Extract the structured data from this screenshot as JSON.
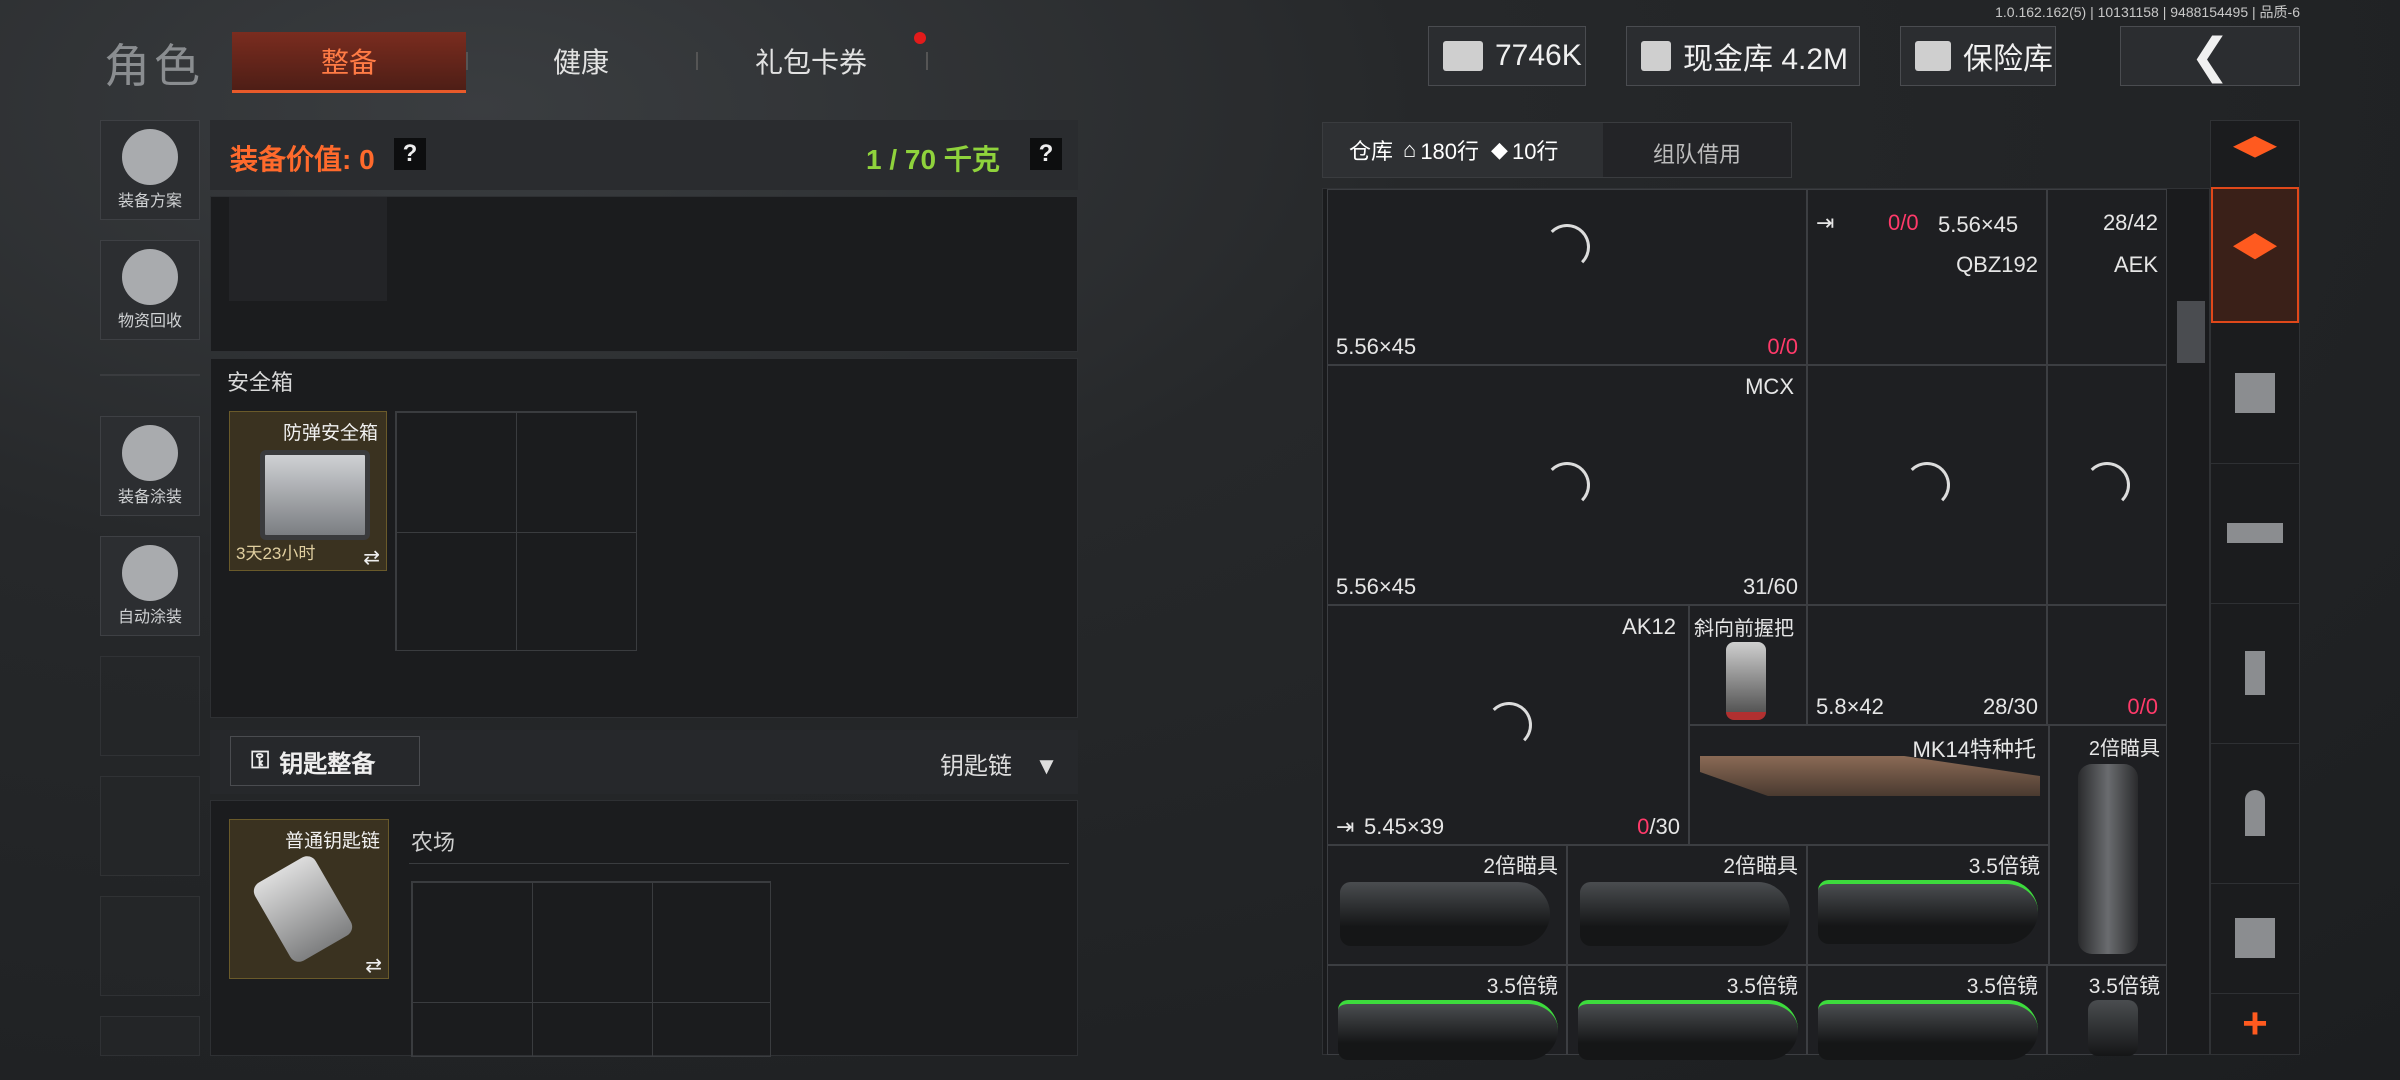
{
  "version": "1.0.162.162(5) | 10131158 | 9488154495 | 品质-6",
  "header": {
    "title": "角色",
    "tabs": [
      {
        "label": "整备",
        "active": true
      },
      {
        "label": "健康",
        "active": false
      },
      {
        "label": "礼包卡券",
        "active": false,
        "badge": true
      }
    ],
    "currency": "7746K",
    "cash_vault": "现金库 4.2M",
    "insurance": "保险库",
    "back_icon": "chevron-left-icon"
  },
  "left_menu": [
    {
      "label": "装备方案",
      "icon": "helmet-grid-icon"
    },
    {
      "label": "物资回收",
      "icon": "recycle-face-icon"
    },
    {
      "label": "装备涂装",
      "icon": "helmet-paint-icon"
    },
    {
      "label": "自动涂装",
      "icon": "brush-gear-icon"
    }
  ],
  "loadout": {
    "value_label": "装备价值: 0",
    "help": "?",
    "weight": "1 / 70 千克"
  },
  "safebox": {
    "title": "安全箱",
    "item_name": "防弹安全箱",
    "timer": "3天23小时",
    "swap_icon": "⇄"
  },
  "keys": {
    "button": "钥匙整备",
    "dropdown": "钥匙链",
    "item_name": "普通钥匙链",
    "location": "农场",
    "swap_icon": "⇄"
  },
  "warehouse": {
    "tab_main": "仓库",
    "rows_a": "180行",
    "rows_b": "10行",
    "tab_team": "组队借用",
    "cells": {
      "c1_caliber": "5.56×45",
      "c1_ammo_a": "0",
      "c1_ammo_b": "0",
      "c2_top_a": "0",
      "c2_top_b": "0",
      "c2_caliber": "5.56×45",
      "c2_count": "28/42",
      "c2_name": "QBZ192",
      "c3_name": "AEK",
      "c4_name": "MCX",
      "c4_caliber": "5.56×45",
      "c4_count": "31/60",
      "c5_name": "AK12",
      "c5_caliber": "5.45×39",
      "c5_ammo_a": "0",
      "c5_ammo_b": "30",
      "c6_name": "斜向前握把",
      "c7_caliber": "5.8×42",
      "c7_count": "28/30",
      "c8_ammo_a": "0",
      "c8_ammo_b": "0",
      "c9_name": "MK14特种托",
      "c10_name": "2倍瞄具",
      "s1": "2倍瞄具",
      "s2": "2倍瞄具",
      "s3": "3.5倍镜",
      "s4": "3.5倍镜",
      "s5": "3.5倍镜",
      "s6": "3.5倍镜",
      "s7": "3.5倍镜"
    }
  },
  "right_tabs": [
    "stack-refresh-icon",
    "stack-icon",
    "vest-icon",
    "rifle-icon",
    "magazine-icon",
    "bullet-icon",
    "scope-icon",
    "plus-icon"
  ],
  "colors": {
    "accent": "#ff7b45",
    "weight_green": "#8fd33c",
    "ammo_red": "#ff3a6a"
  }
}
